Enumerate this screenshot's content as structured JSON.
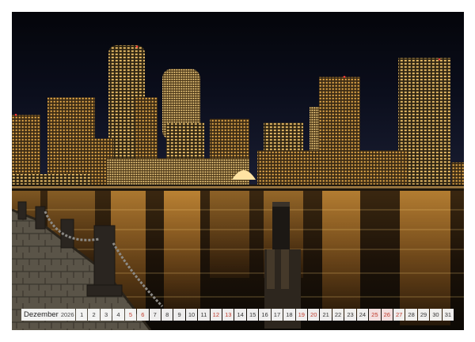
{
  "photo": {
    "subject": "Boston harbor skyline at night"
  },
  "calendar": {
    "month": "Dezember",
    "year": "2026",
    "days": [
      {
        "n": "1",
        "type": "weekday"
      },
      {
        "n": "2",
        "type": "weekday"
      },
      {
        "n": "3",
        "type": "weekday"
      },
      {
        "n": "4",
        "type": "weekday"
      },
      {
        "n": "5",
        "type": "weekend"
      },
      {
        "n": "6",
        "type": "weekend"
      },
      {
        "n": "7",
        "type": "weekday"
      },
      {
        "n": "8",
        "type": "weekday"
      },
      {
        "n": "9",
        "type": "weekday"
      },
      {
        "n": "10",
        "type": "weekday"
      },
      {
        "n": "11",
        "type": "weekday"
      },
      {
        "n": "12",
        "type": "weekend"
      },
      {
        "n": "13",
        "type": "weekend"
      },
      {
        "n": "14",
        "type": "weekday"
      },
      {
        "n": "15",
        "type": "weekday"
      },
      {
        "n": "16",
        "type": "weekday"
      },
      {
        "n": "17",
        "type": "weekday"
      },
      {
        "n": "18",
        "type": "weekday"
      },
      {
        "n": "19",
        "type": "weekend"
      },
      {
        "n": "20",
        "type": "weekend"
      },
      {
        "n": "21",
        "type": "weekday"
      },
      {
        "n": "22",
        "type": "weekday"
      },
      {
        "n": "23",
        "type": "weekday"
      },
      {
        "n": "24",
        "type": "weekday"
      },
      {
        "n": "25",
        "type": "holiday"
      },
      {
        "n": "26",
        "type": "holiday"
      },
      {
        "n": "27",
        "type": "weekend"
      },
      {
        "n": "28",
        "type": "weekday"
      },
      {
        "n": "29",
        "type": "weekday"
      },
      {
        "n": "30",
        "type": "weekday"
      },
      {
        "n": "31",
        "type": "weekday"
      }
    ]
  },
  "colors": {
    "sky_top": "#05060c",
    "sky_horizon": "#1a1f33",
    "city_light": "#f2a93b",
    "water": "#2a1a08",
    "weekend_text": "#c0392b"
  }
}
